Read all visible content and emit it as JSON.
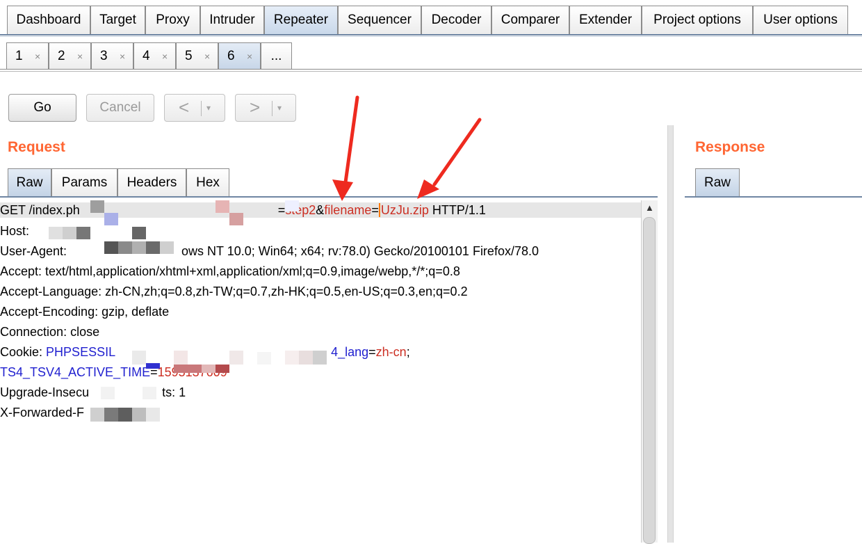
{
  "main_tabs": [
    "Dashboard",
    "Target",
    "Proxy",
    "Intruder",
    "Repeater",
    "Sequencer",
    "Decoder",
    "Comparer",
    "Extender",
    "Project options",
    "User options"
  ],
  "active_main_tab": "Repeater",
  "sub_tabs": [
    "1",
    "2",
    "3",
    "4",
    "5",
    "6"
  ],
  "sub_tab_close": "×",
  "sub_tab_more": "...",
  "active_sub_tab": "6",
  "toolbar": {
    "go": "Go",
    "cancel": "Cancel",
    "back": "<",
    "forward": ">",
    "dropdown": "▾"
  },
  "request": {
    "title": "Request",
    "tabs": [
      "Raw",
      "Params",
      "Headers",
      "Hex"
    ],
    "active_tab": "Raw",
    "lines": {
      "l1_a": "GET /index.ph",
      "l1_b": "=",
      "l1_c": "step2",
      "l1_d": "&",
      "l1_e": "filename",
      "l1_f": "=",
      "l1_g": "UzJu.zip",
      "l1_h": " HTTP/1.1",
      "l2": "Host:",
      "l3_a": "User-Agent: ",
      "l3_b": "ows NT 10.0; Win64; x64; rv:78.0) Gecko/20100101 Firefox/78.0",
      "l4": "Accept: text/html,application/xhtml+xml,application/xml;q=0.9,image/webp,*/*;q=0.8",
      "l5": "Accept-Language: zh-CN,zh;q=0.8,zh-TW;q=0.7,zh-HK;q=0.5,en-US;q=0.3,en;q=0.2",
      "l6": "Accept-Encoding: gzip, deflate",
      "l7": "Connection: close",
      "l8_a": "Cookie: ",
      "l8_b": "PHPSESSIL",
      "l8_c": "4_lang",
      "l8_d": "=",
      "l8_e": "zh-cn",
      "l8_f": ";",
      "l9_a": "TS4_TSV4_ACTIVE_TIME",
      "l9_b": "=",
      "l9_c": "1595137609",
      "l10_a": "Upgrade-Insecu",
      "l10_b": "ts: 1",
      "l11": "X-Forwarded-F"
    }
  },
  "response": {
    "title": "Response",
    "tabs": [
      "Raw"
    ],
    "active_tab": "Raw"
  },
  "scrollbar": {
    "up_arrow": "▲"
  },
  "colors": {
    "section_title": "#ff6633",
    "param_name": "#1f1fcf",
    "param_value": "#cc2e22",
    "annotation_arrow": "#ee2a1f"
  }
}
